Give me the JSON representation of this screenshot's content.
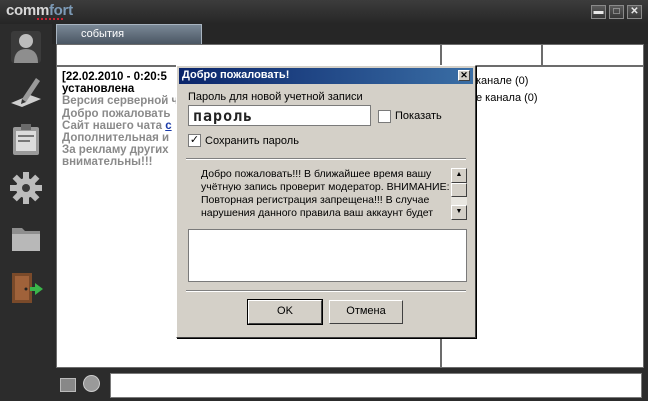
{
  "app": {
    "logo_part1": "comm",
    "logo_part2": "fort",
    "buttons": {
      "minimize": "▬",
      "maximize": "□",
      "close": "✕"
    }
  },
  "tabs": [
    {
      "label": "события"
    }
  ],
  "chat": {
    "timestamp": "[22.02.2010 - 0:20:5",
    "title": "установлена",
    "lines": [
      "Версия серверной ч",
      "Добро пожаловать",
      "Сайт нашего чата ",
      "Дополнительная и",
      "За рекламу других",
      "внимательны!!!"
    ],
    "link_char": "с"
  },
  "channels": {
    "items": [
      "канале (0)",
      "е канала (0)"
    ]
  },
  "dialog": {
    "title": "Добро пожаловать!",
    "close": "✕",
    "password_label": "Пароль для новой учетной записи",
    "password_value": "пароль",
    "show_label": "Показать",
    "show_checked": false,
    "save_label": "Сохранить пароль",
    "save_checked": true,
    "notice": "Добро пожаловать!!! В  ближайшее время вашу учётную запись проверит модератор. ВНИМАНИЕ: Повторная регистрация запрещена!!! В случае нарушения данного правила ваш аккаунт будет",
    "ok": "OK",
    "cancel": "Отмена"
  },
  "colors": {
    "accent": "#0a246a",
    "chrome": "#2b2b2b",
    "tab": "#5a6878"
  }
}
